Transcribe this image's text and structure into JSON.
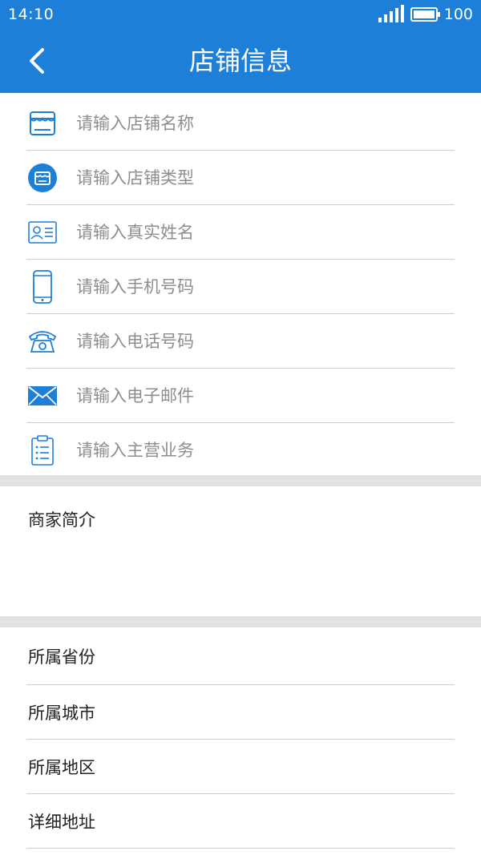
{
  "status_bar": {
    "time": "14:10",
    "battery_level": "100"
  },
  "header": {
    "title": "店铺信息"
  },
  "form": {
    "fields": [
      {
        "placeholder": "请输入店铺名称",
        "icon": "store-icon"
      },
      {
        "placeholder": "请输入店铺类型",
        "icon": "store-type-icon"
      },
      {
        "placeholder": "请输入真实姓名",
        "icon": "id-card-icon"
      },
      {
        "placeholder": "请输入手机号码",
        "icon": "mobile-phone-icon"
      },
      {
        "placeholder": "请输入电话号码",
        "icon": "telephone-icon"
      },
      {
        "placeholder": "请输入电子邮件",
        "icon": "envelope-icon"
      },
      {
        "placeholder": "请输入主营业务",
        "icon": "clipboard-list-icon"
      }
    ]
  },
  "intro": {
    "label": "商家简介"
  },
  "address": {
    "items": [
      {
        "label": "所属省份"
      },
      {
        "label": "所属城市"
      },
      {
        "label": "所属地区"
      },
      {
        "label": "详细地址"
      }
    ]
  },
  "colors": {
    "primary": "#1e7fd8",
    "divider": "#e2e2e2",
    "placeholder": "#8e8e8e"
  }
}
